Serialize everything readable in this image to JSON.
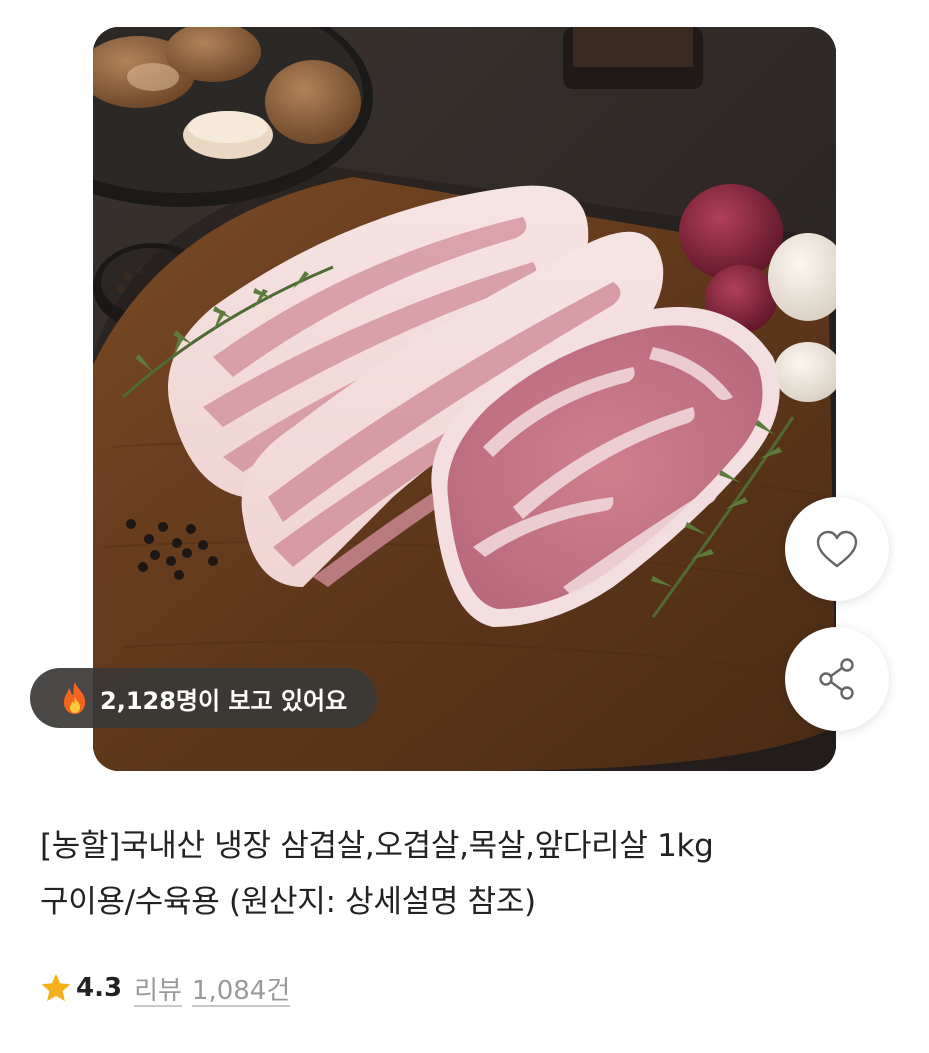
{
  "product": {
    "image_alt": "",
    "viewers_text": "2,128명이 보고 있어요",
    "title_line1": "[농할]국내산 냉장 삼겹살,오겹살,목살,앞다리살 1kg",
    "title_line2": "구이용/수육용 (원산지: 상세설명 참조)",
    "rating": "4.3",
    "review_label": "리뷰",
    "review_count": "1,084건"
  },
  "icons": {
    "viewers": "fire-icon",
    "wish": "heart-outline-icon",
    "share": "share-icon",
    "rating": "star-icon"
  },
  "colors": {
    "star": "#f6b01d",
    "badge_bg": "#3a3836",
    "title_text": "#222222",
    "review_text": "#9a9a9a"
  }
}
